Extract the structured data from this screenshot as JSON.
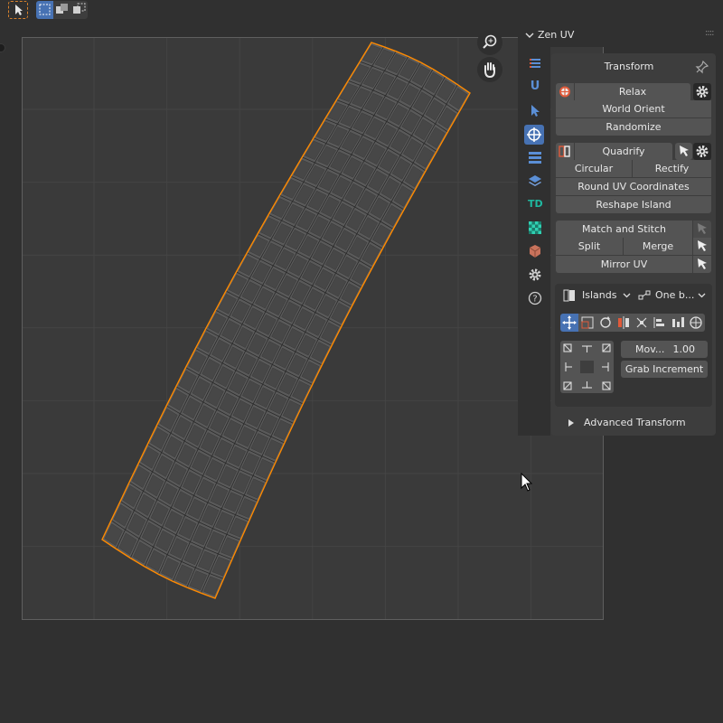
{
  "panel": {
    "title": "Zen UV",
    "section_title": "Transform",
    "buttons": {
      "relax": "Relax",
      "world_orient": "World Orient",
      "randomize": "Randomize",
      "quadrify": "Quadrify",
      "circular": "Circular",
      "rectify": "Rectify",
      "round_uv": "Round UV Coordinates",
      "reshape": "Reshape Island",
      "match_stitch": "Match and Stitch",
      "split": "Split",
      "merge": "Merge",
      "mirror_uv": "Mirror UV"
    },
    "transform": {
      "mode_select": "Islands",
      "pivot_select": "One b...",
      "move_label": "Mov...",
      "move_value": "1.00",
      "grab_increment": "Grab Increment"
    },
    "advanced": "Advanced Transform"
  },
  "tabs": [
    "list-icon",
    "u-icon",
    "select-icon",
    "transform-icon",
    "table-icon",
    "layers-icon",
    "td-icon",
    "checker-icon",
    "package-icon",
    "settings-icon",
    "help-icon"
  ],
  "tab_td_label": "TD",
  "tab_u_label": "U",
  "colors": {
    "accent_blue": "#4772b3",
    "selection_orange": "#ff8a00",
    "panel_bg": "#3d3d3d",
    "button_bg": "#545454"
  }
}
